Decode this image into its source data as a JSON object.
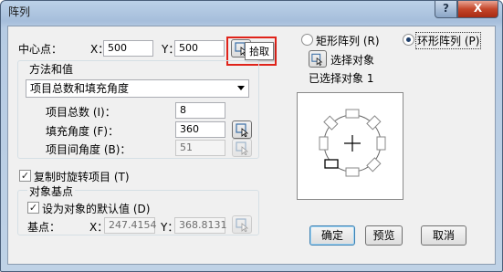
{
  "window": {
    "title": "阵列",
    "help_label": "?",
    "close_label": "X"
  },
  "center": {
    "label": "中心点：",
    "x_label": "X：",
    "x_value": "500",
    "y_label": "Y：",
    "y_value": "500"
  },
  "tooltip": "拾取",
  "method": {
    "group_label": "方法和值",
    "select_value": "项目总数和填充角度",
    "total_label": "项目总数 (I)：",
    "total_value": "8",
    "fill_label": "填充角度 (F)：",
    "fill_value": "360",
    "between_label": "项目间角度 (B)：",
    "between_value": "51"
  },
  "rotate": {
    "label": "复制时旋转项目 (T)",
    "checked": true
  },
  "base": {
    "group_label": "对象基点",
    "default_label": "设为对象的默认值 (D)",
    "default_checked": true,
    "point_label": "基点：",
    "x_label": "X：",
    "x_value": "247.4154",
    "y_label": "Y：",
    "y_value": "368.8131"
  },
  "array_type": {
    "rect_label": "矩形阵列 (R)",
    "polar_label": "环形阵列 (P)",
    "selected": "polar"
  },
  "select_objects": {
    "label": "选择对象",
    "status": "已选择对象 1"
  },
  "buttons": {
    "ok": "确定",
    "preview": "预览",
    "cancel": "取消"
  },
  "colors": {
    "highlight": "#e0231a",
    "title_bar": "#a6bedb",
    "close_button": "#c4462a"
  }
}
